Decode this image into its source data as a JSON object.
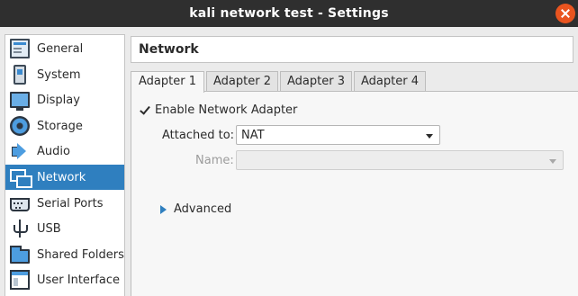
{
  "window": {
    "title": "kali network test - Settings"
  },
  "sidebar": {
    "items": [
      {
        "label": "General",
        "icon": "general-icon"
      },
      {
        "label": "System",
        "icon": "system-icon"
      },
      {
        "label": "Display",
        "icon": "display-icon"
      },
      {
        "label": "Storage",
        "icon": "storage-icon"
      },
      {
        "label": "Audio",
        "icon": "audio-icon"
      },
      {
        "label": "Network",
        "icon": "network-icon",
        "selected": true
      },
      {
        "label": "Serial Ports",
        "icon": "serial-ports-icon"
      },
      {
        "label": "USB",
        "icon": "usb-icon"
      },
      {
        "label": "Shared Folders",
        "icon": "shared-folders-icon"
      },
      {
        "label": "User Interface",
        "icon": "user-interface-icon"
      }
    ]
  },
  "page": {
    "title": "Network"
  },
  "tabs": [
    {
      "label": "Adapter 1",
      "active": true
    },
    {
      "label": "Adapter 2"
    },
    {
      "label": "Adapter 3"
    },
    {
      "label": "Adapter 4"
    }
  ],
  "adapter": {
    "enable_label": "Enable Network Adapter",
    "enabled": true,
    "attached_to_label": "Attached to:",
    "attached_to_value": "NAT",
    "name_label": "Name:",
    "name_value": "",
    "advanced_label": "Advanced"
  },
  "colors": {
    "accent": "#2f7fbf",
    "titlebar": "#2f2f2f",
    "close": "#e9541f"
  }
}
